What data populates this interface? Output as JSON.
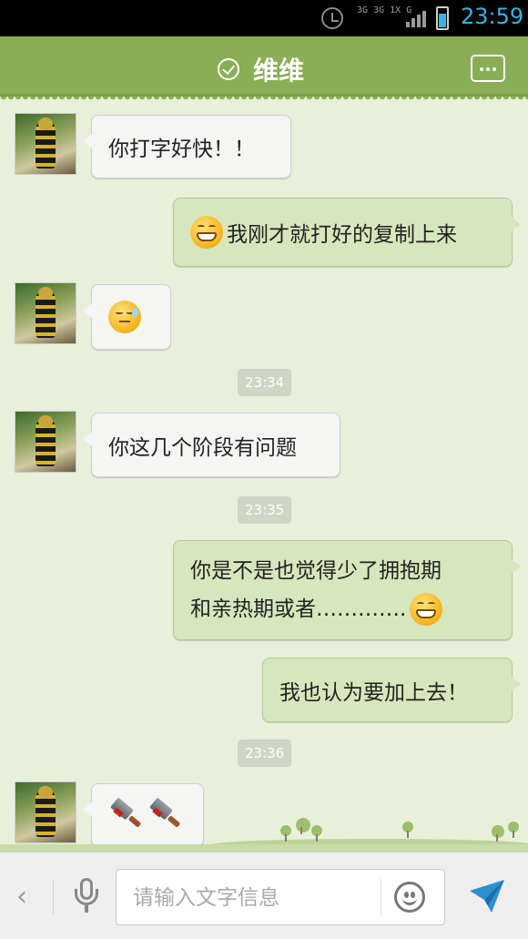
{
  "status_bar": {
    "network": [
      "3G",
      "3G",
      "1X",
      "G"
    ],
    "time": "23:59",
    "battery_level": 0.7,
    "icons": [
      "alarm-clock-icon",
      "signal-icon",
      "battery-icon"
    ]
  },
  "header": {
    "title": "维维",
    "icons": [
      "online-check-icon",
      "more-menu-icon"
    ]
  },
  "messages": [
    {
      "side": "in",
      "text": "你打字好快！！"
    },
    {
      "side": "out",
      "emoji": "grin",
      "text": "我刚才就打好的复制上来"
    },
    {
      "side": "in",
      "emoji": "sweat-face"
    },
    {
      "time": "23:34"
    },
    {
      "side": "in",
      "text": "你这几个阶段有问题"
    },
    {
      "time": "23:35"
    },
    {
      "side": "out",
      "lines": [
        "你是不是也觉得少了拥抱期",
        "和亲热期或者…………."
      ],
      "emoji": "grin"
    },
    {
      "side": "out",
      "text": "我也认为要加上去！"
    },
    {
      "time": "23:36"
    },
    {
      "side": "in",
      "emoji": "knife-knife"
    }
  ],
  "input_bar": {
    "placeholder": "请输入文字信息",
    "icons": [
      "back-chevron-icon",
      "microphone-icon",
      "smiley-icon",
      "send-icon"
    ]
  },
  "colors": {
    "header": "#8aae56",
    "background": "#e8f0dc",
    "outgoing_bubble": "#d7e7bd",
    "incoming_bubble": "#f5f5f3",
    "accent": "#33b5e5"
  }
}
